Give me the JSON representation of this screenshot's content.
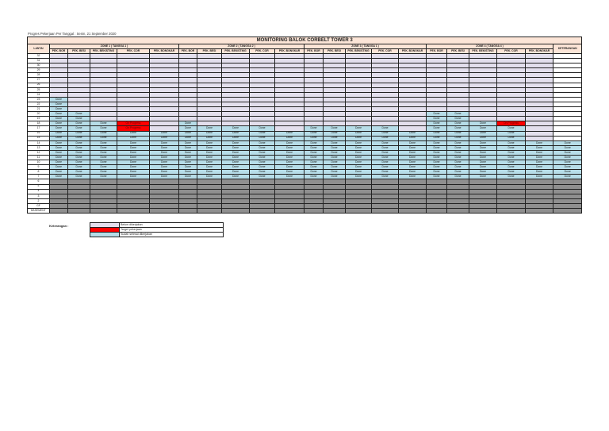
{
  "subtitle": "Progres Pekerjaan Per Tanggal : Senin, 21 September 2020",
  "title": "MONITORING BALOK CORBELT TOWER 3",
  "lantai_header": "LANTAI",
  "keterangan_header": "KETERANGAN",
  "zones": [
    {
      "label": "ZONE 1 ( TANGGA 1 )"
    },
    {
      "label": "ZONE 2 ( TANGGA 2 )"
    },
    {
      "label": "ZONE 3 ( TANGGA 1 )"
    },
    {
      "label": "ZONE 4 ( TANGGA 4 )"
    }
  ],
  "columns": [
    "PEK. BOR",
    "PEK. BESI",
    "PEK. BEKISTING",
    "PEK. COR",
    "PEK. BONGKAR"
  ],
  "status_colors": {
    "empty": "#e4dfec",
    "done": "#b7dee8",
    "progress": "#ff0000",
    "na": "#8f8f8f",
    "header": "#fce4d6"
  },
  "rows": [
    {
      "floor": "32",
      "cells": [
        "",
        "",
        "",
        "",
        "",
        "",
        "",
        "",
        "",
        "",
        "",
        "",
        "",
        "",
        "",
        "",
        "",
        "",
        "",
        ""
      ],
      "ket": ""
    },
    {
      "floor": "31",
      "cells": [
        "",
        "",
        "",
        "",
        "",
        "",
        "",
        "",
        "",
        "",
        "",
        "",
        "",
        "",
        "",
        "",
        "",
        "",
        "",
        ""
      ],
      "ket": ""
    },
    {
      "floor": "30",
      "cells": [
        "",
        "",
        "",
        "",
        "",
        "",
        "",
        "",
        "",
        "",
        "",
        "",
        "",
        "",
        "",
        "",
        "",
        "",
        "",
        ""
      ],
      "ket": ""
    },
    {
      "floor": "29",
      "cells": [
        "",
        "",
        "",
        "",
        "",
        "",
        "",
        "",
        "",
        "",
        "",
        "",
        "",
        "",
        "",
        "",
        "",
        "",
        "",
        ""
      ],
      "ket": ""
    },
    {
      "floor": "28",
      "cells": [
        "",
        "",
        "",
        "",
        "",
        "",
        "",
        "",
        "",
        "",
        "",
        "",
        "",
        "",
        "",
        "",
        "",
        "",
        "",
        ""
      ],
      "ket": ""
    },
    {
      "floor": "27",
      "cells": [
        "",
        "",
        "",
        "",
        "",
        "",
        "",
        "",
        "",
        "",
        "",
        "",
        "",
        "",
        "",
        "",
        "",
        "",
        "",
        ""
      ],
      "ket": ""
    },
    {
      "floor": "26",
      "cells": [
        "",
        "",
        "",
        "",
        "",
        "",
        "",
        "",
        "",
        "",
        "",
        "",
        "",
        "",
        "",
        "",
        "",
        "",
        "",
        ""
      ],
      "ket": ""
    },
    {
      "floor": "25",
      "cells": [
        "",
        "",
        "",
        "",
        "",
        "",
        "",
        "",
        "",
        "",
        "",
        "",
        "",
        "",
        "",
        "",
        "",
        "",
        "",
        ""
      ],
      "ket": ""
    },
    {
      "floor": "24",
      "cells": [
        "",
        "",
        "",
        "",
        "",
        "",
        "",
        "",
        "",
        "",
        "",
        "",
        "",
        "",
        "",
        "",
        "",
        "",
        "",
        ""
      ],
      "ket": ""
    },
    {
      "floor": "23",
      "cells": [
        "Done",
        "",
        "",
        "",
        "",
        "",
        "",
        "",
        "",
        "",
        "",
        "",
        "",
        "",
        "",
        "",
        "",
        "",
        "",
        ""
      ],
      "ket": ""
    },
    {
      "floor": "22",
      "cells": [
        "Done",
        "",
        "",
        "",
        "",
        "",
        "",
        "",
        "",
        "",
        "",
        "",
        "",
        "",
        "",
        "",
        "",
        "",
        "",
        ""
      ],
      "ket": ""
    },
    {
      "floor": "21",
      "cells": [
        "Done",
        "",
        "",
        "",
        "",
        "",
        "",
        "",
        "",
        "",
        "",
        "",
        "",
        "",
        "",
        "",
        "",
        "",
        "",
        ""
      ],
      "ket": ""
    },
    {
      "floor": "20",
      "cells": [
        "Done",
        "Done",
        "",
        "",
        "",
        "",
        "",
        "",
        "",
        "",
        "",
        "",
        "",
        "",
        "",
        "Done",
        "Done",
        "",
        "",
        ""
      ],
      "ket": ""
    },
    {
      "floor": "19",
      "cells": [
        "Done",
        "Done",
        "",
        "",
        "",
        "",
        "",
        "",
        "",
        "",
        "",
        "",
        "",
        "",
        "",
        "Done",
        "Done",
        "",
        "",
        ""
      ],
      "ket": ""
    },
    {
      "floor": "18",
      "cells": [
        "Done",
        "Done",
        "Done",
        "On Progress",
        "",
        "Done",
        "",
        "",
        "",
        "",
        "",
        "",
        "",
        "",
        "",
        "Done",
        "Done",
        "Done",
        "On Progress",
        ""
      ],
      "ket": ""
    },
    {
      "floor": "17",
      "cells": [
        "Done",
        "Done",
        "Done",
        "On Progress",
        "",
        "Done",
        "Done",
        "Done",
        "Done",
        "",
        "Done",
        "Done",
        "Done",
        "Done",
        "",
        "Done",
        "Done",
        "Done",
        "Done",
        ""
      ],
      "ket": ""
    },
    {
      "floor": "16",
      "cells": [
        "Done",
        "Done",
        "Done",
        "Done",
        "Done",
        "Done",
        "Done",
        "Done",
        "Done",
        "Done",
        "Done",
        "Done",
        "Done",
        "Done",
        "Done",
        "Done",
        "Done",
        "Done",
        "Done",
        ""
      ],
      "ket": ""
    },
    {
      "floor": "15",
      "cells": [
        "Done",
        "Done",
        "Done",
        "Done",
        "Done",
        "Done",
        "Done",
        "Done",
        "Done",
        "Done",
        "Done",
        "Done",
        "Done",
        "Done",
        "Done",
        "Done",
        "Done",
        "Done",
        "Done",
        ""
      ],
      "ket": ""
    },
    {
      "floor": "14",
      "cells": [
        "Done",
        "Done",
        "Done",
        "Done",
        "Done",
        "Done",
        "Done",
        "Done",
        "Done",
        "Done",
        "Done",
        "Done",
        "Done",
        "Done",
        "Done",
        "Done",
        "Done",
        "Done",
        "Done",
        "Done"
      ],
      "ket": "Done"
    },
    {
      "floor": "13",
      "cells": [
        "Done",
        "Done",
        "Done",
        "Done",
        "Done",
        "Done",
        "Done",
        "Done",
        "Done",
        "Done",
        "Done",
        "Done",
        "Done",
        "Done",
        "Done",
        "Done",
        "Done",
        "Done",
        "Done",
        "Done"
      ],
      "ket": "Done"
    },
    {
      "floor": "12",
      "cells": [
        "Done",
        "Done",
        "Done",
        "Done",
        "Done",
        "Done",
        "Done",
        "Done",
        "Done",
        "Done",
        "Done",
        "Done",
        "Done",
        "Done",
        "Done",
        "Done",
        "Done",
        "Done",
        "Done",
        "Done"
      ],
      "ket": "Done"
    },
    {
      "floor": "11",
      "cells": [
        "Done",
        "Done",
        "Done",
        "Done",
        "Done",
        "Done",
        "Done",
        "Done",
        "Done",
        "Done",
        "Done",
        "Done",
        "Done",
        "Done",
        "Done",
        "Done",
        "Done",
        "Done",
        "Done",
        "Done"
      ],
      "ket": "Done"
    },
    {
      "floor": "10",
      "cells": [
        "Done",
        "Done",
        "Done",
        "Done",
        "Done",
        "Done",
        "Done",
        "Done",
        "Done",
        "Done",
        "Done",
        "Done",
        "Done",
        "Done",
        "Done",
        "Done",
        "Done",
        "Done",
        "Done",
        "Done"
      ],
      "ket": "Done"
    },
    {
      "floor": "9",
      "cells": [
        "Done",
        "Done",
        "Done",
        "Done",
        "Done",
        "Done",
        "Done",
        "Done",
        "Done",
        "Done",
        "Done",
        "Done",
        "Done",
        "Done",
        "Done",
        "Done",
        "Done",
        "Done",
        "Done",
        "Done"
      ],
      "ket": "Done"
    },
    {
      "floor": "8",
      "cells": [
        "Done",
        "Done",
        "Done",
        "Done",
        "Done",
        "Done",
        "Done",
        "Done",
        "Done",
        "Done",
        "Done",
        "Done",
        "Done",
        "Done",
        "Done",
        "Done",
        "Done",
        "Done",
        "Done",
        "Done"
      ],
      "ket": "Done"
    },
    {
      "floor": "7",
      "cells": [
        "Done",
        "Done",
        "Done",
        "Done",
        "Done",
        "Done",
        "Done",
        "Done",
        "Done",
        "Done",
        "Done",
        "Done",
        "Done",
        "Done",
        "Done",
        "Done",
        "Done",
        "Done",
        "Done",
        "Done"
      ],
      "ket": "Done"
    },
    {
      "floor": "6",
      "na": true,
      "cells": [],
      "ket": ""
    },
    {
      "floor": "5",
      "na": true,
      "cells": [],
      "ket": ""
    },
    {
      "floor": "4",
      "na": true,
      "cells": [],
      "ket": ""
    },
    {
      "floor": "3",
      "na": true,
      "cells": [],
      "ket": ""
    },
    {
      "floor": "2",
      "na": true,
      "cells": [],
      "ket": ""
    },
    {
      "floor": "GF",
      "na": true,
      "cells": [],
      "ket": ""
    },
    {
      "floor": "BASEMENT",
      "na": true,
      "cells": [],
      "ket": ""
    }
  ],
  "legend": {
    "label": "Keterangan :",
    "items": [
      {
        "state": "empty",
        "text": "Belum dikerjakan"
      },
      {
        "state": "progress",
        "text": "Target pekerjaan"
      },
      {
        "state": "done",
        "text": "Sudah selesai dikerjakan"
      }
    ]
  }
}
